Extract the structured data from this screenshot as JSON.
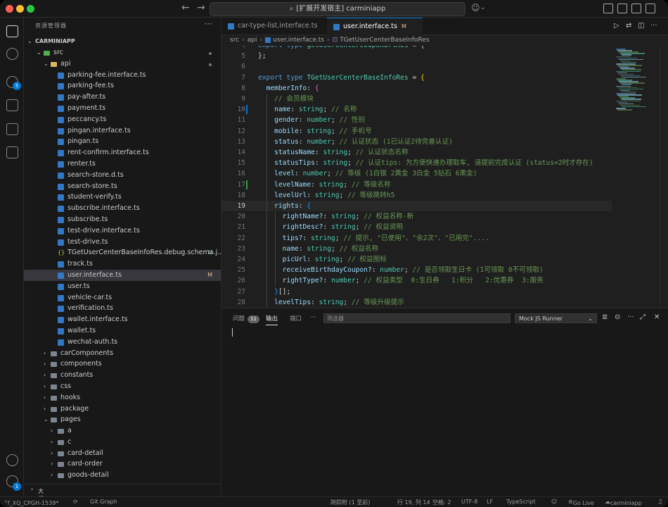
{
  "window": {
    "title": "[扩展开发宿主] carminiapp"
  },
  "explorer": {
    "title": "资源管理器",
    "root": "CARMINIAPP",
    "tree": [
      {
        "label": "src",
        "depth": 1,
        "kind": "src",
        "open": true
      },
      {
        "label": "api",
        "depth": 2,
        "kind": "api",
        "open": true
      },
      {
        "label": "parking-fee.interface.ts",
        "depth": 3,
        "kind": "ts"
      },
      {
        "label": "parking-fee.ts",
        "depth": 3,
        "kind": "ts"
      },
      {
        "label": "pay-after.ts",
        "depth": 3,
        "kind": "ts"
      },
      {
        "label": "payment.ts",
        "depth": 3,
        "kind": "ts"
      },
      {
        "label": "peccancy.ts",
        "depth": 3,
        "kind": "ts"
      },
      {
        "label": "pingan.interface.ts",
        "depth": 3,
        "kind": "ts"
      },
      {
        "label": "pingan.ts",
        "depth": 3,
        "kind": "ts"
      },
      {
        "label": "rent-confirm.interface.ts",
        "depth": 3,
        "kind": "ts"
      },
      {
        "label": "renter.ts",
        "depth": 3,
        "kind": "ts"
      },
      {
        "label": "search-store.d.ts",
        "depth": 3,
        "kind": "ts"
      },
      {
        "label": "search-store.ts",
        "depth": 3,
        "kind": "ts"
      },
      {
        "label": "student-verify.ts",
        "depth": 3,
        "kind": "ts"
      },
      {
        "label": "subscribe.interface.ts",
        "depth": 3,
        "kind": "ts"
      },
      {
        "label": "subscribe.ts",
        "depth": 3,
        "kind": "ts"
      },
      {
        "label": "test-drive.interface.ts",
        "depth": 3,
        "kind": "ts"
      },
      {
        "label": "test-drive.ts",
        "depth": 3,
        "kind": "ts"
      },
      {
        "label": "TGetUserCenterBaseInfoRes.debug.schema.j...",
        "depth": 3,
        "kind": "json",
        "badge": "U"
      },
      {
        "label": "track.ts",
        "depth": 3,
        "kind": "ts"
      },
      {
        "label": "user.interface.ts",
        "depth": 3,
        "kind": "ts",
        "badge": "M",
        "selected": true
      },
      {
        "label": "user.ts",
        "depth": 3,
        "kind": "ts"
      },
      {
        "label": "vehicle-car.ts",
        "depth": 3,
        "kind": "ts"
      },
      {
        "label": "verification.ts",
        "depth": 3,
        "kind": "ts"
      },
      {
        "label": "wallet.interface.ts",
        "depth": 3,
        "kind": "ts"
      },
      {
        "label": "wallet.ts",
        "depth": 3,
        "kind": "ts"
      },
      {
        "label": "wechat-auth.ts",
        "depth": 3,
        "kind": "ts"
      },
      {
        "label": "carComponents",
        "depth": 2,
        "kind": "folder",
        "open": false
      },
      {
        "label": "components",
        "depth": 2,
        "kind": "folder",
        "open": false
      },
      {
        "label": "constants",
        "depth": 2,
        "kind": "folder",
        "open": false
      },
      {
        "label": "css",
        "depth": 2,
        "kind": "folder",
        "open": false
      },
      {
        "label": "hooks",
        "depth": 2,
        "kind": "folder",
        "open": false
      },
      {
        "label": "package",
        "depth": 2,
        "kind": "folder",
        "open": false
      },
      {
        "label": "pages",
        "depth": 2,
        "kind": "folder",
        "open": true
      },
      {
        "label": "a",
        "depth": 3,
        "kind": "folder",
        "open": false
      },
      {
        "label": "c",
        "depth": 3,
        "kind": "folder",
        "open": false
      },
      {
        "label": "card-detail",
        "depth": 3,
        "kind": "folder",
        "open": false
      },
      {
        "label": "card-order",
        "depth": 3,
        "kind": "folder",
        "open": false
      },
      {
        "label": "goods-detail",
        "depth": 3,
        "kind": "folder",
        "open": false
      }
    ],
    "outline_label": "大纲"
  },
  "tabs": [
    {
      "label": "car-type-list.interface.ts",
      "active": false
    },
    {
      "label": "user.interface.ts",
      "active": true,
      "modified": "M"
    }
  ],
  "breadcrumb": [
    "src",
    "api",
    "user.interface.ts",
    "TGetUserCenterBaseInfoRes"
  ],
  "code": [
    {
      "n": "4",
      "t": [
        [
          "kw",
          "export type "
        ],
        [
          "ty",
          "getUserCenterCouponUrlRes"
        ],
        [
          "pu",
          " = {"
        ]
      ]
    },
    {
      "n": "5",
      "t": [
        [
          "pu",
          "};"
        ]
      ]
    },
    {
      "n": "6",
      "t": []
    },
    {
      "n": "7",
      "t": [
        [
          "kw",
          "export type "
        ],
        [
          "ty",
          "TGetUserCenterBaseInfoRes"
        ],
        [
          "pu",
          " = "
        ],
        [
          "br",
          "{"
        ]
      ]
    },
    {
      "n": "8",
      "t": [
        [
          "pu",
          "  "
        ],
        [
          "pr",
          "memberInfo"
        ],
        [
          "pu",
          ": "
        ],
        [
          "br2",
          "{"
        ]
      ]
    },
    {
      "n": "9",
      "t": [
        [
          "pu",
          "    "
        ],
        [
          "cm",
          "// 会员模块"
        ]
      ]
    },
    {
      "n": "10",
      "t": [
        [
          "pu",
          "    "
        ],
        [
          "pr",
          "name"
        ],
        [
          "pu",
          ": "
        ],
        [
          "ty",
          "string"
        ],
        [
          "pu",
          "; "
        ],
        [
          "cm",
          "// 名称"
        ]
      ],
      "gutter": "mod"
    },
    {
      "n": "11",
      "t": [
        [
          "pu",
          "    "
        ],
        [
          "pr",
          "gender"
        ],
        [
          "pu",
          ": "
        ],
        [
          "ty",
          "number"
        ],
        [
          "pu",
          "; "
        ],
        [
          "cm",
          "// 性别"
        ]
      ]
    },
    {
      "n": "12",
      "t": [
        [
          "pu",
          "    "
        ],
        [
          "pr",
          "mobile"
        ],
        [
          "pu",
          ": "
        ],
        [
          "ty",
          "string"
        ],
        [
          "pu",
          "; "
        ],
        [
          "cm",
          "// 手机号"
        ]
      ]
    },
    {
      "n": "13",
      "t": [
        [
          "pu",
          "    "
        ],
        [
          "pr",
          "status"
        ],
        [
          "pu",
          ": "
        ],
        [
          "ty",
          "number"
        ],
        [
          "pu",
          "; "
        ],
        [
          "cm",
          "// 认证状态 (1已认证2待完善认证)"
        ]
      ]
    },
    {
      "n": "14",
      "t": [
        [
          "pu",
          "    "
        ],
        [
          "pr",
          "statusName"
        ],
        [
          "pu",
          ": "
        ],
        [
          "ty",
          "string"
        ],
        [
          "pu",
          "; "
        ],
        [
          "cm",
          "// 认证状态名称"
        ]
      ]
    },
    {
      "n": "15",
      "t": [
        [
          "pu",
          "    "
        ],
        [
          "pr",
          "statusTips"
        ],
        [
          "pu",
          ": "
        ],
        [
          "ty",
          "string"
        ],
        [
          "pu",
          "; "
        ],
        [
          "cm",
          "// 认证tips: 为方便快速办理取车, 请提前完成认证 (status=2时才存在)"
        ]
      ]
    },
    {
      "n": "16",
      "t": [
        [
          "pu",
          "    "
        ],
        [
          "pr",
          "level"
        ],
        [
          "pu",
          ": "
        ],
        [
          "ty",
          "number"
        ],
        [
          "pu",
          "; "
        ],
        [
          "cm",
          "// 等级 (1白银 2黄金 3白金 5钻石 6黑金)"
        ]
      ]
    },
    {
      "n": "17",
      "t": [
        [
          "pu",
          "    "
        ],
        [
          "pr",
          "levelName"
        ],
        [
          "pu",
          ": "
        ],
        [
          "ty",
          "string"
        ],
        [
          "pu",
          "; "
        ],
        [
          "cm",
          "// 等级名称"
        ]
      ],
      "gutter": "add"
    },
    {
      "n": "18",
      "t": [
        [
          "pu",
          "    "
        ],
        [
          "pr",
          "levelUrl"
        ],
        [
          "pu",
          ": "
        ],
        [
          "ty",
          "string"
        ],
        [
          "pu",
          "; "
        ],
        [
          "cm",
          "// 等级跳转h5"
        ]
      ]
    },
    {
      "n": "19",
      "t": [
        [
          "pu",
          "    "
        ],
        [
          "pr",
          "rights"
        ],
        [
          "pu",
          ": "
        ],
        [
          "br3",
          "{"
        ]
      ],
      "current": true
    },
    {
      "n": "20",
      "t": [
        [
          "pu",
          "      "
        ],
        [
          "pr",
          "rightName?"
        ],
        [
          "pu",
          ": "
        ],
        [
          "ty",
          "string"
        ],
        [
          "pu",
          "; "
        ],
        [
          "cm",
          "// 权益名称-新"
        ]
      ]
    },
    {
      "n": "21",
      "t": [
        [
          "pu",
          "      "
        ],
        [
          "pr",
          "rightDesc?"
        ],
        [
          "pu",
          ": "
        ],
        [
          "ty",
          "string"
        ],
        [
          "pu",
          "; "
        ],
        [
          "cm",
          "// 权益说明"
        ]
      ]
    },
    {
      "n": "22",
      "t": [
        [
          "pu",
          "      "
        ],
        [
          "pr",
          "tips?"
        ],
        [
          "pu",
          ": "
        ],
        [
          "ty",
          "string"
        ],
        [
          "pu",
          "; "
        ],
        [
          "cm",
          "// 提示, \"已使用\"、\"余2次\"、\"已用完\"...."
        ]
      ]
    },
    {
      "n": "23",
      "t": [
        [
          "pu",
          "      "
        ],
        [
          "pr",
          "name"
        ],
        [
          "pu",
          ": "
        ],
        [
          "ty",
          "string"
        ],
        [
          "pu",
          "; "
        ],
        [
          "cm",
          "// 权益名称"
        ]
      ]
    },
    {
      "n": "24",
      "t": [
        [
          "pu",
          "      "
        ],
        [
          "pr",
          "picUrl"
        ],
        [
          "pu",
          ": "
        ],
        [
          "ty",
          "string"
        ],
        [
          "pu",
          "; "
        ],
        [
          "cm",
          "// 权益图标"
        ]
      ]
    },
    {
      "n": "25",
      "t": [
        [
          "pu",
          "      "
        ],
        [
          "pr",
          "receiveBirthdayCoupon?"
        ],
        [
          "pu",
          ": "
        ],
        [
          "ty",
          "number"
        ],
        [
          "pu",
          "; "
        ],
        [
          "cm",
          "// 是否领取生日卡 (1可领取 0不可领取)"
        ]
      ]
    },
    {
      "n": "26",
      "t": [
        [
          "pu",
          "      "
        ],
        [
          "pr",
          "rightType?"
        ],
        [
          "pu",
          ": "
        ],
        [
          "ty",
          "number"
        ],
        [
          "pu",
          "; "
        ],
        [
          "cm",
          "// 权益类型  0:生日券   1:积分   2:优惠券  3:服务"
        ]
      ]
    },
    {
      "n": "27",
      "t": [
        [
          "pu",
          "    "
        ],
        [
          "br3",
          "}"
        ],
        [
          "pu",
          "[];"
        ]
      ]
    },
    {
      "n": "28",
      "t": [
        [
          "pu",
          "    "
        ],
        [
          "pr",
          "levelTips"
        ],
        [
          "pu",
          ": "
        ],
        [
          "ty",
          "string"
        ],
        [
          "pu",
          "; "
        ],
        [
          "cm",
          "// 等级升级提示"
        ]
      ]
    }
  ],
  "panel": {
    "tabs": [
      {
        "label": "问题",
        "badge": "11"
      },
      {
        "label": "输出",
        "active": true
      },
      {
        "label": "端口"
      },
      {
        "label": "···"
      }
    ],
    "filter_placeholder": "筛选器",
    "channel": "Mock JS Runner"
  },
  "statusbar": {
    "branch": "f_XQ_CPGH-1539*",
    "sync": "⟳",
    "git_graph": "Git Graph",
    "tracking": "跨踪附 (1 至前)",
    "position": "行 19, 列 14",
    "spaces": "空格: 2",
    "encoding": "UTF-8",
    "eol": "LF",
    "language": "TypeScript",
    "go_live": "Go Live",
    "project": "carminiapp"
  },
  "colors": {
    "accent": "#0078d4",
    "bg": "#1f1f1f",
    "sidebar": "#181818"
  }
}
